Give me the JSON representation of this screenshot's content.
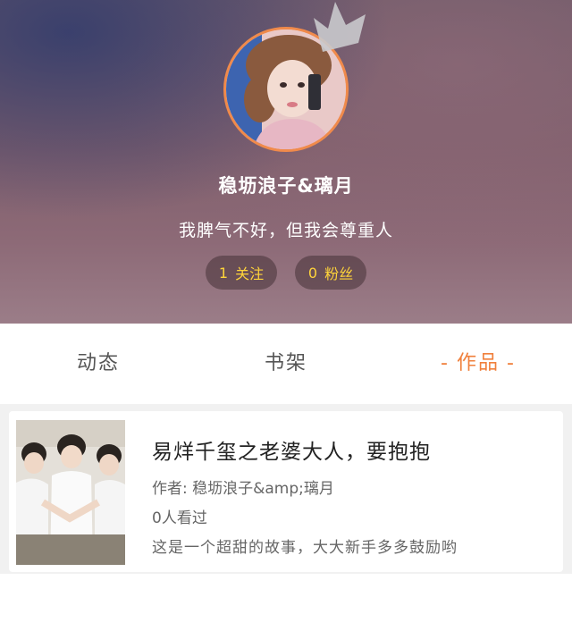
{
  "profile": {
    "username": "稳坜浪子&璃月",
    "bio": "我脾气不好，但我会尊重人",
    "following_count": "1",
    "following_label": "关注",
    "fans_count": "0",
    "fans_label": "粉丝",
    "avatar_border_color": "#f08a4b"
  },
  "tabs": [
    {
      "label": "动态",
      "active": false
    },
    {
      "label": "书架",
      "active": false
    },
    {
      "label": "作品",
      "active": true,
      "dash": "-"
    }
  ],
  "accent_color": "#f0803c",
  "works": [
    {
      "title": "易烊千玺之老婆大人，要抱抱",
      "author_line": "作者: 稳坜浪子&amp;璃月",
      "views": "0人看过",
      "description": "这是一个超甜的故事，大大新手多多鼓励哟"
    }
  ]
}
